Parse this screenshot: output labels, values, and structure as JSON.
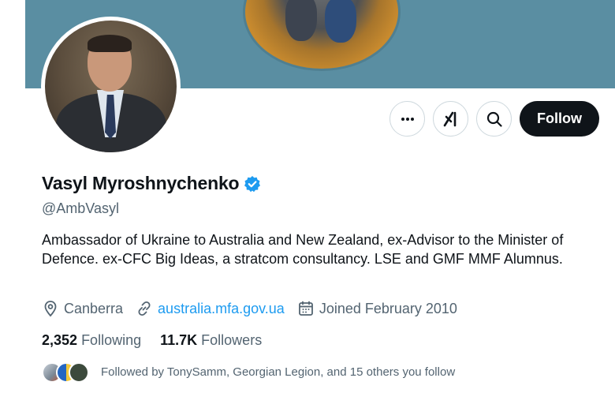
{
  "header": {
    "more_label": "More",
    "grok_label": "Grok",
    "search_label": "Search",
    "follow_label": "Follow"
  },
  "profile": {
    "name": "Vasyl Myroshnychenko",
    "handle": "@AmbVasyl",
    "bio": "Ambassador of Ukraine to Australia and New Zealand, ex-Advisor to the Minister of Defence. ex-CFC Big Ideas, a stratcom consultancy. LSE and GMF MMF Alumnus.",
    "location": "Canberra",
    "website": "australia.mfa.gov.ua",
    "joined": "Joined February 2010"
  },
  "stats": {
    "following_count": "2,352",
    "following_label": "Following",
    "followers_count": "11.7K",
    "followers_label": "Followers"
  },
  "followed_by": {
    "text": "Followed by TonySamm, Georgian Legion, and 15 others you follow"
  },
  "icons": {
    "more": "ellipsis-icon",
    "grok": "grok-icon",
    "search": "search-icon",
    "verified": "verified-badge-icon",
    "location": "location-pin-icon",
    "link": "link-icon",
    "calendar": "calendar-icon"
  },
  "colors": {
    "banner": "#5a8ea2",
    "follow_button": "#0f1419",
    "link": "#1d9bf0",
    "verified": "#1d9bf0",
    "secondary_text": "#536471"
  }
}
